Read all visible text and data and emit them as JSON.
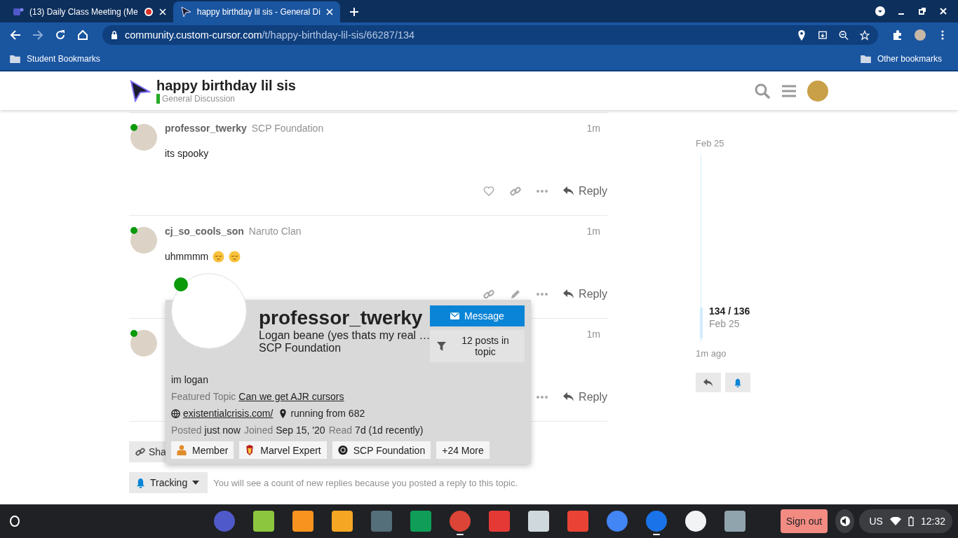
{
  "browser": {
    "tabs": [
      {
        "title": "(13) Daily Class Meeting (Me",
        "kind": "meeting",
        "recording": true,
        "selected": false
      },
      {
        "title": "happy birthday lil sis - General Di",
        "kind": "forum",
        "recording": false,
        "selected": true
      }
    ],
    "address": {
      "host": "community.custom-cursor.com",
      "path": "/t/happy-birthday-lil-sis/66287/134"
    },
    "bookmarks": [
      "Student Bookmarks"
    ],
    "other_bookmarks": "Other bookmarks"
  },
  "topic": {
    "title": "happy birthday lil sis",
    "category": "General Discussion"
  },
  "posts": [
    {
      "username": "professor_twerky",
      "flair": "SCP Foundation",
      "time": "1m",
      "body": "its spooky",
      "online": true,
      "actions": [
        {
          "kind": "like"
        },
        {
          "kind": "link"
        },
        {
          "kind": "more"
        }
      ],
      "reply": "Reply"
    },
    {
      "username": "cj_so_cools_son",
      "flair": "Naruto Clan",
      "time": "1m",
      "body": "uhmmmm",
      "reactions": [
        {
          "kind": "pensive"
        },
        {
          "kind": "pensive"
        }
      ],
      "online": true,
      "actions": [
        {
          "kind": "link"
        },
        {
          "kind": "edit"
        },
        {
          "kind": "more"
        }
      ],
      "reply": "Reply"
    },
    {
      "time": "1m",
      "online": true,
      "actions": [
        {
          "kind": "more"
        }
      ],
      "reply": "Reply"
    }
  ],
  "card": {
    "username": "professor_twerky",
    "name": "Logan beane (yes thats my real …",
    "title": "SCP Foundation",
    "online": true,
    "message": "Message",
    "filter": "12 posts in topic",
    "bio": "im logan",
    "featured_label": "Featured Topic",
    "featured": "Can we get AJR cursors",
    "website": "existentialcrisis.com/",
    "location": "running from 682",
    "stats": [
      {
        "label": "Posted",
        "value": "just now"
      },
      {
        "label": "Joined",
        "value": "Sep 15, '20"
      },
      {
        "label": "Read",
        "value": "7d (1d recently)"
      }
    ],
    "badges": [
      {
        "kind": "member",
        "label": "Member"
      },
      {
        "kind": "marvel",
        "label": "Marvel Expert"
      },
      {
        "kind": "scp",
        "label": "SCP Foundation"
      },
      {
        "kind": "more",
        "label": "+24 More"
      }
    ]
  },
  "share": "Sha",
  "tracking": {
    "label": "Tracking",
    "reason": "You will see a count of new replies because you posted a reply to this topic."
  },
  "timeline": {
    "start": "Feb 25",
    "position": "134 / 136",
    "position_date": "Feb 25",
    "end": "1m ago"
  },
  "taskbar": {
    "apps": [
      {
        "kind": "round",
        "color": "#5059c9",
        "running": false
      },
      {
        "kind": "square",
        "color": "#8cc63f",
        "running": false
      },
      {
        "kind": "square",
        "color": "#f7931e",
        "running": false
      },
      {
        "kind": "square",
        "color": "#f5a623",
        "running": false
      },
      {
        "kind": "square",
        "color": "#546e7a",
        "running": false
      },
      {
        "kind": "square",
        "color": "#0f9d58",
        "running": false
      },
      {
        "kind": "round",
        "color": "#db4437",
        "running": true
      },
      {
        "kind": "square",
        "color": "#e53935",
        "running": false
      },
      {
        "kind": "square",
        "color": "#cfd8dc",
        "running": false
      },
      {
        "kind": "square",
        "color": "#ea4335",
        "running": false
      },
      {
        "kind": "round",
        "color": "#4285f4",
        "running": false
      },
      {
        "kind": "round",
        "color": "#1a73e8",
        "running": true
      },
      {
        "kind": "round",
        "color": "#f1f3f4",
        "running": false
      },
      {
        "kind": "square",
        "color": "#90a4ae",
        "running": false
      }
    ],
    "sign_out": "Sign out",
    "input": "US",
    "time": "12:32"
  }
}
